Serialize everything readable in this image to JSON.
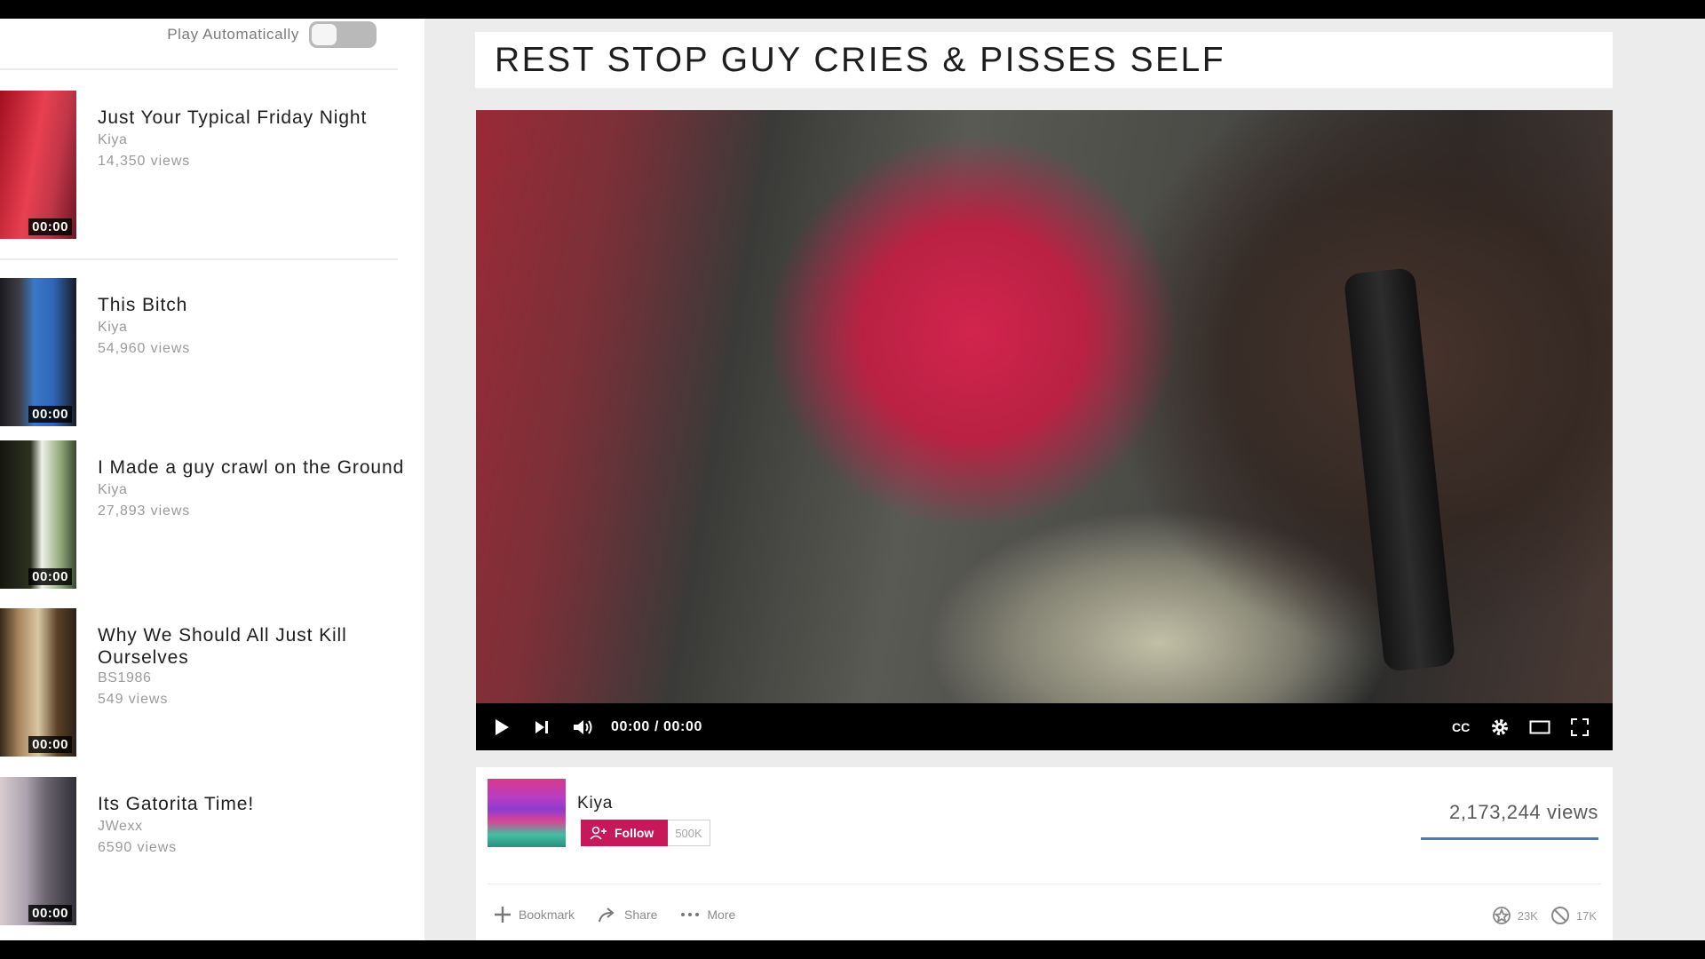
{
  "sidebar": {
    "autoplay_label": "Play Automatically",
    "autoplay_on": false,
    "items": [
      {
        "title": "Just Your Typical Friday Night",
        "author": "Kiya",
        "views": "14,350 views",
        "duration": "00:00"
      },
      {
        "title": "This Bitch",
        "author": "Kiya",
        "views": "54,960 views",
        "duration": "00:00"
      },
      {
        "title": "I Made a guy crawl on the Ground",
        "author": "Kiya",
        "views": "27,893 views",
        "duration": "00:00"
      },
      {
        "title": "Why We Should All Just Kill Ourselves",
        "author": "BS1986",
        "views": "549 views",
        "duration": "00:00"
      },
      {
        "title": "Its Gatorita Time!",
        "author": "JWexx",
        "views": "6590 views",
        "duration": "00:00"
      }
    ]
  },
  "video": {
    "title": "REST STOP GUY CRIES & PISSES SELF",
    "time": "00:00 / 00:00",
    "controls": {
      "play_icon": "play-icon",
      "next_icon": "skip-next-icon",
      "volume_icon": "volume-icon",
      "captions_icon": "closed-captions-icon",
      "settings_icon": "gear-icon",
      "theater_icon": "theater-mode-icon",
      "fullscreen_icon": "fullscreen-icon"
    }
  },
  "channel": {
    "name": "Kiya",
    "follow_label": "Follow",
    "subscriber_count": "500K",
    "accent_color": "#c7185a"
  },
  "stats": {
    "views": "2,173,244 views",
    "likes": "23K",
    "dislikes": "17K"
  },
  "actions": {
    "bookmark": "Bookmark",
    "share": "Share",
    "more": "More"
  }
}
